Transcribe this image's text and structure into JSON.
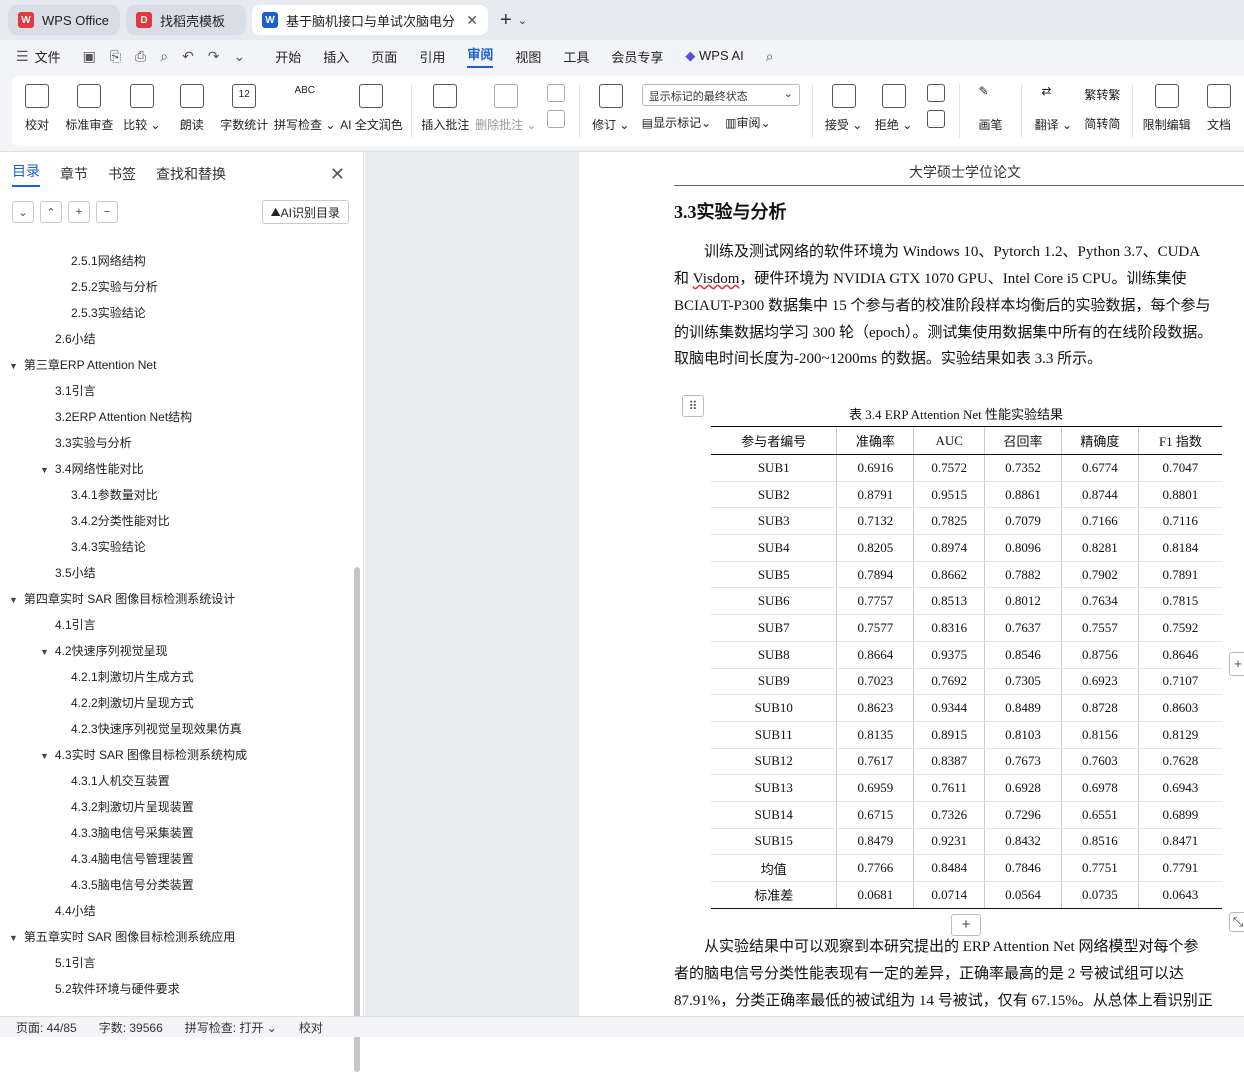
{
  "tabs": [
    {
      "label": "WPS Office",
      "logo": "W",
      "color": "#e0393e"
    },
    {
      "label": "找稻壳模板",
      "logo": "D",
      "color": "#e0393e"
    },
    {
      "label": "基于脑机接口与单试次脑电分",
      "logo": "W",
      "color": "#1a5fd1"
    }
  ],
  "menu": {
    "file": "文件",
    "items": [
      "开始",
      "插入",
      "页面",
      "引用",
      "审阅",
      "视图",
      "工具",
      "会员专享"
    ],
    "active": "审阅",
    "wps_ai": "WPS AI"
  },
  "ribbon": {
    "proof": "校对",
    "std_review": "标准审查",
    "compare": "比较",
    "read": "朗读",
    "wordcount": "字数统计",
    "wordcount_icon": "12",
    "spell": "拼写检查",
    "spell_icon": "ABC",
    "ai_polish": "AI 全文润色",
    "insert_comment": "插入批注",
    "delete_comment": "删除批注",
    "track": "修订",
    "markup_select": "显示标记的最终状态",
    "show_markup": "显示标记",
    "review": "审阅",
    "accept": "接受",
    "reject": "拒绝",
    "pen": "画笔",
    "translate": "翻译",
    "to_trad": "转繁",
    "to_simp": "转简",
    "restrict": "限制编辑",
    "doc": "文档"
  },
  "sidebar": {
    "tabs": [
      "目录",
      "章节",
      "书签",
      "查找和替换"
    ],
    "ai_toc": "AI识别目录",
    "toc": [
      {
        "label": "2.5.1网络结构",
        "level": 3
      },
      {
        "label": "2.5.2实验与分析",
        "level": 3
      },
      {
        "label": "2.5.3实验结论",
        "level": 3
      },
      {
        "label": "2.6小结",
        "level": 2
      },
      {
        "label": "第三章ERP Attention Net",
        "level": 1,
        "expanded": true
      },
      {
        "label": "3.1引言",
        "level": 2
      },
      {
        "label": "3.2ERP Attention Net结构",
        "level": 2
      },
      {
        "label": "3.3实验与分析",
        "level": 2
      },
      {
        "label": "3.4网络性能对比",
        "level": 2,
        "expanded": true
      },
      {
        "label": "3.4.1参数量对比",
        "level": 3
      },
      {
        "label": "3.4.2分类性能对比",
        "level": 3
      },
      {
        "label": "3.4.3实验结论",
        "level": 3
      },
      {
        "label": "3.5小结",
        "level": 2
      },
      {
        "label": "第四章实时 SAR 图像目标检测系统设计",
        "level": 1,
        "expanded": true
      },
      {
        "label": "4.1引言",
        "level": 2
      },
      {
        "label": "4.2快速序列视觉呈现",
        "level": 2,
        "expanded": true
      },
      {
        "label": "4.2.1刺激切片生成方式",
        "level": 3
      },
      {
        "label": "4.2.2刺激切片呈现方式",
        "level": 3
      },
      {
        "label": "4.2.3快速序列视觉呈现效果仿真",
        "level": 3
      },
      {
        "label": "4.3实时 SAR 图像目标检测系统构成",
        "level": 2,
        "expanded": true
      },
      {
        "label": "4.3.1人机交互装置",
        "level": 3
      },
      {
        "label": "4.3.2刺激切片呈现装置",
        "level": 3
      },
      {
        "label": "4.3.3脑电信号采集装置",
        "level": 3
      },
      {
        "label": "4.3.4脑电信号管理装置",
        "level": 3
      },
      {
        "label": "4.3.5脑电信号分类装置",
        "level": 3
      },
      {
        "label": "4.4小结",
        "level": 2
      },
      {
        "label": "第五章实时 SAR 图像目标检测系统应用",
        "level": 1,
        "expanded": true
      },
      {
        "label": "5.1引言",
        "level": 2
      },
      {
        "label": "5.2软件环境与硬件要求",
        "level": 2
      }
    ]
  },
  "doc": {
    "header": "大学硕士学位论文",
    "section": "3.3实验与分析",
    "para1": [
      "训练及测试网络的软件环境为 Windows 10、Pytorch 1.2、Python 3.7、CUDA",
      "和 Visdom，硬件环境为 NVIDIA GTX 1070 GPU、Intel Core i5 CPU。训练集使",
      "BCIAUT-P300 数据集中 15 个参与者的校准阶段样本均衡后的实验数据，每个参与",
      "的训练集数据均学习 300 轮（epoch）。测试集使用数据集中所有的在线阶段数据。",
      "取脑电时间长度为-200~1200ms 的数据。实验结果如表 3.3 所示。"
    ],
    "caption": "表 3.4 ERP Attention Net 性能实验结果",
    "para2": [
      "从实验结果中可以观察到本研究提出的 ERP Attention Net 网络模型对每个参",
      "者的脑电信号分类性能表现有一定的差异，正确率最高的是 2 号被试组可以达",
      "87.91%，分类正确率最低的被试组为 14 号被试，仅有 67.15%。从总体上看识别正"
    ]
  },
  "chart_data": {
    "type": "table",
    "columns": [
      "参与者编号",
      "准确率",
      "AUC",
      "召回率",
      "精确度",
      "F1 指数"
    ],
    "rows": [
      [
        "SUB1",
        "0.6916",
        "0.7572",
        "0.7352",
        "0.6774",
        "0.7047"
      ],
      [
        "SUB2",
        "0.8791",
        "0.9515",
        "0.8861",
        "0.8744",
        "0.8801"
      ],
      [
        "SUB3",
        "0.7132",
        "0.7825",
        "0.7079",
        "0.7166",
        "0.7116"
      ],
      [
        "SUB4",
        "0.8205",
        "0.8974",
        "0.8096",
        "0.8281",
        "0.8184"
      ],
      [
        "SUB5",
        "0.7894",
        "0.8662",
        "0.7882",
        "0.7902",
        "0.7891"
      ],
      [
        "SUB6",
        "0.7757",
        "0.8513",
        "0.8012",
        "0.7634",
        "0.7815"
      ],
      [
        "SUB7",
        "0.7577",
        "0.8316",
        "0.7637",
        "0.7557",
        "0.7592"
      ],
      [
        "SUB8",
        "0.8664",
        "0.9375",
        "0.8546",
        "0.8756",
        "0.8646"
      ],
      [
        "SUB9",
        "0.7023",
        "0.7692",
        "0.7305",
        "0.6923",
        "0.7107"
      ],
      [
        "SUB10",
        "0.8623",
        "0.9344",
        "0.8489",
        "0.8728",
        "0.8603"
      ],
      [
        "SUB11",
        "0.8135",
        "0.8915",
        "0.8103",
        "0.8156",
        "0.8129"
      ],
      [
        "SUB12",
        "0.7617",
        "0.8387",
        "0.7673",
        "0.7603",
        "0.7628"
      ],
      [
        "SUB13",
        "0.6959",
        "0.7611",
        "0.6928",
        "0.6978",
        "0.6943"
      ],
      [
        "SUB14",
        "0.6715",
        "0.7326",
        "0.7296",
        "0.6551",
        "0.6899"
      ],
      [
        "SUB15",
        "0.8479",
        "0.9231",
        "0.8432",
        "0.8516",
        "0.8471"
      ]
    ],
    "summary": [
      [
        "均值",
        "0.7766",
        "0.8484",
        "0.7846",
        "0.7751",
        "0.7791"
      ],
      [
        "标准差",
        "0.0681",
        "0.0714",
        "0.0564",
        "0.0735",
        "0.0643"
      ]
    ]
  },
  "status": {
    "page": "页面: 44/85",
    "words": "字数: 39566",
    "spell": "拼写检查: 打开",
    "proof": "校对"
  }
}
